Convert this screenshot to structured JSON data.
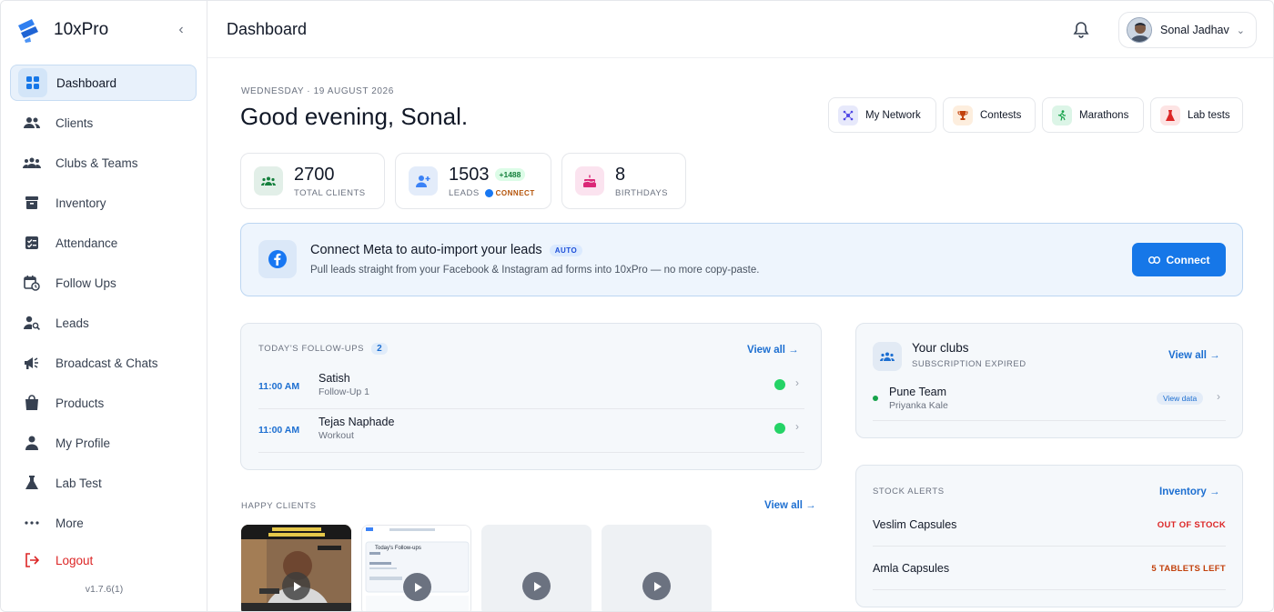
{
  "brand": {
    "name": "10xPro"
  },
  "sidebar": {
    "items": [
      {
        "label": "Dashboard",
        "icon": "grid-icon"
      },
      {
        "label": "Clients",
        "icon": "users-icon"
      },
      {
        "label": "Clubs & Teams",
        "icon": "groups-icon"
      },
      {
        "label": "Inventory",
        "icon": "archive-icon"
      },
      {
        "label": "Attendance",
        "icon": "checklist-icon"
      },
      {
        "label": "Follow Ups",
        "icon": "calendar-clock-icon"
      },
      {
        "label": "Leads",
        "icon": "person-search-icon"
      },
      {
        "label": "Broadcast & Chats",
        "icon": "megaphone-icon"
      },
      {
        "label": "Products",
        "icon": "shopping-bag-icon"
      },
      {
        "label": "My Profile",
        "icon": "person-icon"
      },
      {
        "label": "Lab Test",
        "icon": "flask-icon"
      },
      {
        "label": "More",
        "icon": "more-dots-icon"
      },
      {
        "label": "Logout",
        "icon": "logout-icon"
      }
    ],
    "version": "v1.7.6(1)"
  },
  "header": {
    "title": "Dashboard",
    "user_name": "Sonal Jadhav"
  },
  "main": {
    "date": "WEDNESDAY · 19 AUGUST 2026",
    "greeting": "Good evening, Sonal.",
    "quick_links": [
      "My Network",
      "Contests",
      "Marathons",
      "Lab tests"
    ],
    "stats": {
      "clients": {
        "value": "2700",
        "label": "TOTAL CLIENTS"
      },
      "leads": {
        "value": "1503",
        "delta": "+1488",
        "label": "LEADS",
        "source": "CONNECT"
      },
      "birthdays": {
        "value": "8",
        "label": "BIRTHDAYS"
      }
    },
    "meta": {
      "title": "Connect Meta to auto-import your leads",
      "badge": "AUTO",
      "subtitle": "Pull leads straight from your Facebook & Instagram ad forms into 10xPro — no more copy-paste.",
      "button": "Connect"
    },
    "followups": {
      "title": "TODAY'S FOLLOW-UPS",
      "count": "2",
      "view_all": "View all →",
      "rows": [
        {
          "time": "11:00 AM",
          "name": "Satish",
          "sub": "Follow-Up 1"
        },
        {
          "time": "11:00 AM",
          "name": "Tejas Naphade",
          "sub": "Workout"
        }
      ]
    },
    "happy_clients": {
      "title": "HAPPY CLIENTS",
      "view_all": "View all →",
      "thumb_caption": "Today's Follow-ups"
    },
    "clubs": {
      "title": "Your clubs",
      "subtitle": "SUBSCRIPTION EXPIRED",
      "view_all": "View all →",
      "rows": [
        {
          "name": "Pune Team",
          "owner": "Priyanka Kale",
          "action": "View data"
        }
      ]
    },
    "stock": {
      "title": "STOCK ALERTS",
      "link": "Inventory →",
      "rows": [
        {
          "name": "Veslim Capsules",
          "state": "OUT OF STOCK",
          "color": "#dc2626"
        },
        {
          "name": "Amla Capsules",
          "state": "5 TABLETS LEFT",
          "color": "#c2410c"
        }
      ]
    }
  },
  "colors": {
    "accent": "#1677e8",
    "active_bg": "#e8f1fb",
    "logout": "#dc2626"
  }
}
